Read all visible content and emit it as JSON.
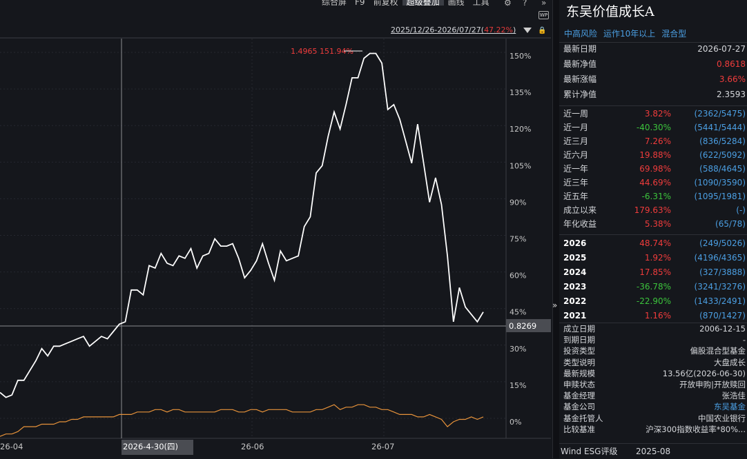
{
  "toolbar": {
    "items": [
      "综合屏",
      "F9",
      "前复权",
      "超级叠加",
      "画线",
      "工具"
    ],
    "active_index": 3,
    "icons": [
      "gear-icon",
      "help-icon",
      "double-chevron-right-icon"
    ]
  },
  "wp_badge": "WP",
  "range": {
    "text": "2025/12/26-2026/07/27(",
    "pct": "47.22%",
    "close": ")"
  },
  "chart_data": {
    "type": "line",
    "y_ticks": [
      "150%",
      "135%",
      "120%",
      "105%",
      "90%",
      "75%",
      "60%",
      "45%",
      "30%",
      "15%",
      "0%"
    ],
    "x_ticks": [
      "26-04",
      "2026-4-30(四)",
      "26-06",
      "26-07"
    ],
    "peak_label": "1.4965 151.94%",
    "current_value_label": "0.8269",
    "series": [
      {
        "values": [
          12,
          10,
          11,
          17,
          17,
          21,
          25,
          30,
          27,
          31,
          31,
          32,
          33,
          34,
          35,
          31,
          33,
          35,
          34,
          37,
          40,
          41,
          54,
          54,
          52,
          64,
          63,
          69,
          65,
          64,
          68,
          67,
          71,
          63,
          68,
          69,
          75,
          72,
          72,
          73,
          67,
          59,
          62,
          66,
          73,
          65,
          58,
          70,
          66,
          67,
          68,
          80,
          84,
          102,
          105,
          117,
          127,
          120,
          130,
          141,
          141,
          149,
          151,
          151,
          147,
          128,
          130,
          124,
          115,
          106,
          122,
          106,
          90,
          100,
          89,
          68,
          41,
          55,
          47,
          44,
          41,
          45
        ]
      },
      {
        "values": [
          -6,
          -5,
          -5,
          -4,
          -2,
          -2,
          -2,
          -1,
          -1,
          -1,
          0,
          0,
          1,
          1,
          2,
          2,
          2,
          2,
          2,
          2,
          3,
          3,
          3,
          4,
          4,
          4,
          5,
          5,
          4,
          5,
          5,
          4,
          4,
          4,
          4,
          4,
          4,
          5,
          5,
          5,
          4,
          4,
          5,
          5,
          4,
          5,
          5,
          5,
          5,
          4,
          4,
          4,
          4,
          5,
          5,
          6,
          7,
          5,
          6,
          6,
          7,
          7,
          6,
          6,
          5,
          5,
          4,
          3,
          3,
          3,
          2,
          2,
          3,
          2,
          1,
          -2,
          0,
          1,
          1,
          2,
          1,
          2
        ]
      }
    ],
    "ylim": [
      -5,
      160
    ]
  },
  "fund": {
    "name": "东吴价值成长A",
    "tags": [
      "中高风险",
      "运作10年以上",
      "混合型"
    ],
    "latest": [
      {
        "label": "最新日期",
        "value": "2026-07-27",
        "color": "white"
      },
      {
        "label": "最新净值",
        "value": "0.8618",
        "color": "red"
      },
      {
        "label": "最新涨幅",
        "value": "3.66%",
        "color": "red"
      },
      {
        "label": "累计净值",
        "value": "2.3593",
        "color": "white"
      }
    ],
    "periods": [
      {
        "label": "近一周",
        "pct": "3.82%",
        "rank": "(2362/5475)",
        "color": "red"
      },
      {
        "label": "近一月",
        "pct": "-40.30%",
        "rank": "(5441/5444)",
        "color": "green"
      },
      {
        "label": "近三月",
        "pct": "7.26%",
        "rank": "(836/5284)",
        "color": "red"
      },
      {
        "label": "近六月",
        "pct": "19.88%",
        "rank": "(622/5092)",
        "color": "red"
      },
      {
        "label": "近一年",
        "pct": "69.98%",
        "rank": "(588/4645)",
        "color": "red"
      },
      {
        "label": "近三年",
        "pct": "44.69%",
        "rank": "(1090/3590)",
        "color": "red"
      },
      {
        "label": "近五年",
        "pct": "-6.31%",
        "rank": "(1095/1981)",
        "color": "green"
      },
      {
        "label": "成立以来",
        "pct": "179.63%",
        "rank": "(-)",
        "color": "red"
      },
      {
        "label": "年化收益",
        "pct": "5.38%",
        "rank": "(65/78)",
        "color": "red"
      }
    ],
    "years": [
      {
        "label": "2026",
        "pct": "48.74%",
        "rank": "(249/5026)",
        "color": "red"
      },
      {
        "label": "2025",
        "pct": "1.92%",
        "rank": "(4196/4365)",
        "color": "red"
      },
      {
        "label": "2024",
        "pct": "17.85%",
        "rank": "(327/3888)",
        "color": "red"
      },
      {
        "label": "2023",
        "pct": "-36.78%",
        "rank": "(3241/3276)",
        "color": "green"
      },
      {
        "label": "2022",
        "pct": "-22.90%",
        "rank": "(1433/2491)",
        "color": "green"
      },
      {
        "label": "2021",
        "pct": "1.16%",
        "rank": "(870/1427)",
        "color": "red"
      }
    ],
    "info": [
      {
        "label": "成立日期",
        "value": "2006-12-15"
      },
      {
        "label": "到期日期",
        "value": "-"
      },
      {
        "label": "投资类型",
        "value": "偏股混合型基金"
      },
      {
        "label": "类型说明",
        "value": "大盘成长"
      },
      {
        "label": "最新规模",
        "value": "13.56亿(2026-06-30)"
      },
      {
        "label": "申赎状态",
        "value": "开放申购|开放赎回"
      },
      {
        "label": "基金经理",
        "value": "张浩佳"
      },
      {
        "label": "基金公司",
        "value": "东吴基金",
        "link": true
      },
      {
        "label": "基金托管人",
        "value": "中国农业银行"
      },
      {
        "label": "比较基准",
        "value": "沪深300指数收益率*80%..."
      }
    ],
    "esg": {
      "label": "Wind ESG评级",
      "value": "2025-08"
    }
  }
}
